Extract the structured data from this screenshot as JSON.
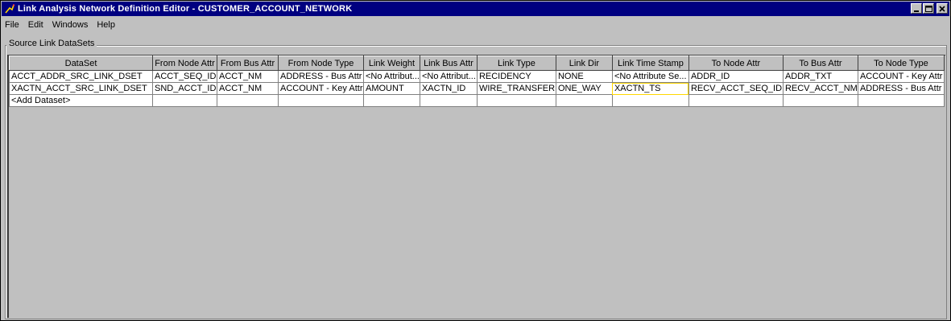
{
  "window": {
    "title": "Link Analysis Network Definition Editor - CUSTOMER_ACCOUNT_NETWORK"
  },
  "menu": [
    "File",
    "Edit",
    "Windows",
    "Help"
  ],
  "panel": {
    "title": "Source Link DataSets"
  },
  "table": {
    "columns": [
      "DataSet",
      "From Node Attr",
      "From Bus Attr",
      "From Node Type",
      "Link Weight",
      "Link Bus Attr",
      "Link Type",
      "Link Dir",
      "Link Time Stamp",
      "To Node Attr",
      "To Bus Attr",
      "To Node Type"
    ],
    "rows": [
      [
        "ACCT_ADDR_SRC_LINK_DSET",
        "ACCT_SEQ_ID",
        "ACCT_NM",
        "ADDRESS - Bus Attr",
        "<No Attribut...",
        "<No Attribut...",
        "RECIDENCY",
        "NONE",
        "<No Attribute Se...",
        "ADDR_ID",
        "ADDR_TXT",
        "ACCOUNT - Key Attr"
      ],
      [
        "XACTN_ACCT_SRC_LINK_DSET",
        "SND_ACCT_ID",
        "ACCT_NM",
        "ACCOUNT - Key Attr",
        "AMOUNT",
        "XACTN_ID",
        "WIRE_TRANSFER",
        "ONE_WAY",
        "XACTN_TS",
        "RECV_ACCT_SEQ_ID",
        "RECV_ACCT_NM",
        "ADDRESS - Bus Attr"
      ],
      [
        "<Add Dataset>",
        "",
        "",
        "",
        "",
        "",
        "",
        "",
        "",
        "",
        "",
        ""
      ]
    ],
    "focused_cell": "1.8"
  }
}
